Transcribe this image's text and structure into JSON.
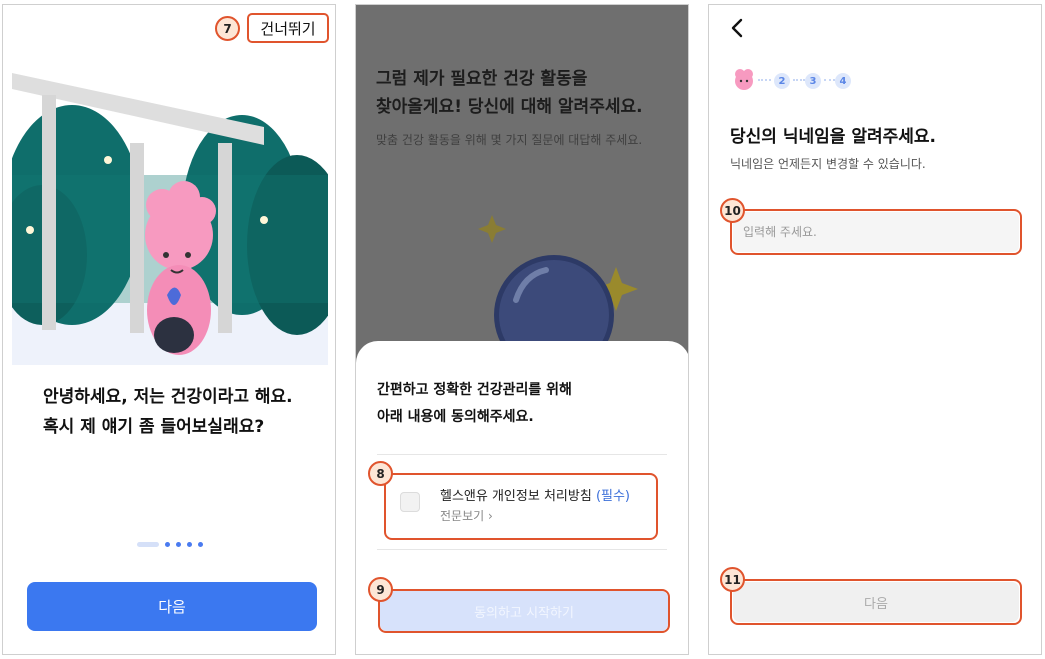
{
  "screen1": {
    "skip_label": "건너뛰기",
    "intro_line1": "안녕하세요, 저는 건강이라고 해요.",
    "intro_line2": "혹시 제 얘기 좀 들어보실래요?",
    "pager_total": 5,
    "pager_current": 1,
    "next_label": "다음",
    "callout_skip": "7"
  },
  "screen2": {
    "title_line1": "그럼 제가 필요한 건강 활동을",
    "title_line2": "찾아올게요! 당신에 대해 알려주세요.",
    "subtitle": "맞춤 건강 활동을 위해 몇 가지 질문에 대답해 주세요.",
    "sheet_title_line1": "간편하고 정확한 건강관리를 위해",
    "sheet_title_line2": "아래 내용에 동의해주세요.",
    "agreement_label": "헬스앤유 개인정보 처리방침",
    "agreement_required": "(필수)",
    "agreement_checked": false,
    "view_full_label": "전문보기",
    "start_label": "동의하고 시작하기",
    "callout_agreement": "8",
    "callout_start": "9"
  },
  "screen3": {
    "steps": [
      "2",
      "3",
      "4"
    ],
    "title": "당신의 닉네임을 알려주세요.",
    "subtitle": "닉네임은 언제든지 변경할 수 있습니다.",
    "nickname_value": "",
    "nickname_placeholder": "입력해 주세요.",
    "next_label": "다음",
    "callout_input": "10",
    "callout_next": "11"
  },
  "colors": {
    "primary": "#3b78f0",
    "callout": "#e0542d",
    "callout_fill": "#fde6d6",
    "mascot": "#f79ac0",
    "leaf": "#0f6e6b"
  }
}
